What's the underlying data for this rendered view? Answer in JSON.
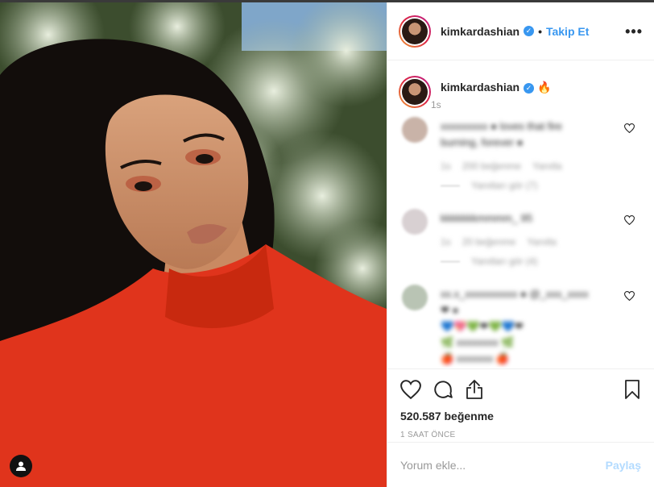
{
  "post": {
    "username": "kimkardashian",
    "separator": "•",
    "follow_label": "Takip Et",
    "more_label": "•••"
  },
  "caption": {
    "username": "kimkardashian",
    "emoji": "🔥",
    "time": "1s"
  },
  "comments": [
    {
      "lines": [
        "xxxxxxxxx  ●  loves that fire",
        "burning, forever ●"
      ],
      "time": "1s",
      "likes": "200 beğenme",
      "reply": "Yanıtla",
      "view_replies": "Yanıtları gör (7)",
      "avatar_color": "#c9b3a8"
    },
    {
      "lines": [
        "kkkkkkkmmmm_ 95"
      ],
      "time": "1s",
      "likes": "20 beğenme",
      "reply": "Yanıtla",
      "view_replies": "Yanıtları gör (4)",
      "avatar_color": "#d8d0d2"
    },
    {
      "lines": [
        "xx.x_xxxxxxxxxx ● @_xxx_xxxx",
        "❤ ●",
        "💙💖💚❤💚💙❤",
        "🌿 xxxxxxxx 🌿",
        "🍎 xxxxxxx 🍎"
      ],
      "time": "",
      "likes": "",
      "reply": "",
      "view_replies": "",
      "avatar_color": "#b9c4b4"
    }
  ],
  "actions": {
    "like_icon": "heart-outline-icon",
    "comment_icon": "speech-bubble-icon",
    "share_icon": "share-arrow-icon",
    "save_icon": "bookmark-icon"
  },
  "likes_text": "520.587 beğenme",
  "time_ago": "1 SAAT ÖNCE",
  "comment_input": {
    "placeholder": "Yorum ekle...",
    "value": ""
  },
  "share_label": "Paylaş",
  "colors": {
    "accent": "#3897f0",
    "share_disabled": "#b3dbff",
    "border": "#efefef",
    "muted": "#999999"
  }
}
